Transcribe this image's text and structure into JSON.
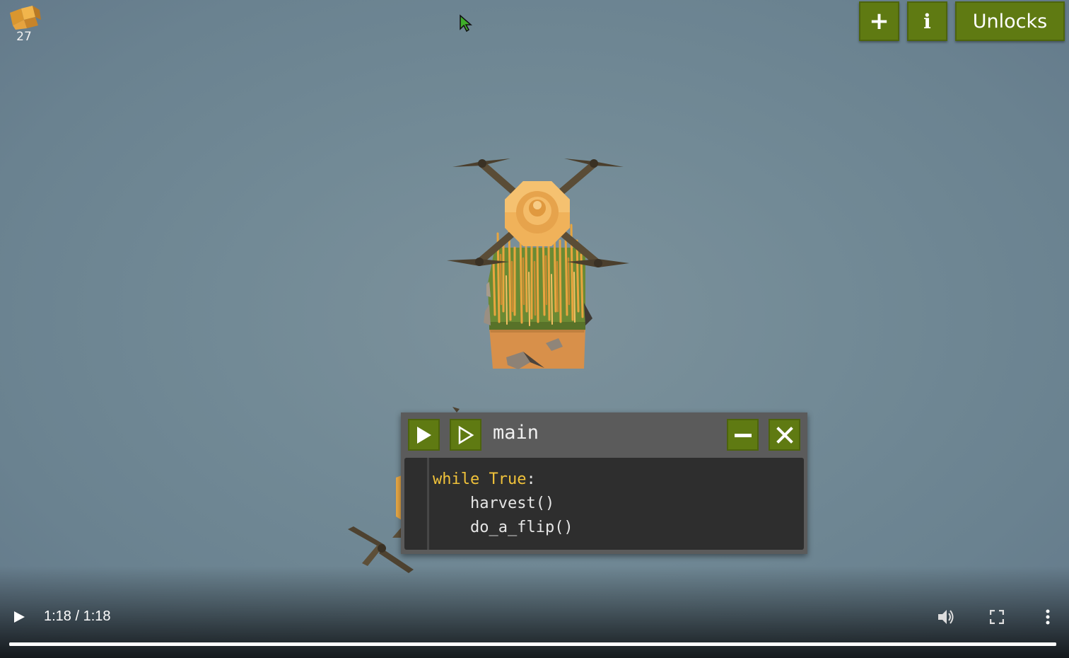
{
  "hud": {
    "resource_icon": "hay-icon",
    "resource_count": "27"
  },
  "top_buttons": {
    "plus_label": "+",
    "info_label": "i",
    "unlocks_label": "Unlocks"
  },
  "editor": {
    "title": "main",
    "code_lines": [
      {
        "keyword": "while True",
        "rest": ":"
      },
      {
        "indent": "    ",
        "text": "harvest()"
      },
      {
        "indent": "    ",
        "text": "do_a_flip()"
      }
    ]
  },
  "video": {
    "time": "1:18 / 1:18",
    "progress": 1.0
  },
  "colors": {
    "button_green": "#5f7a12",
    "keyword_yellow": "#f0c23a",
    "background_blue_gray": "#728a96"
  }
}
